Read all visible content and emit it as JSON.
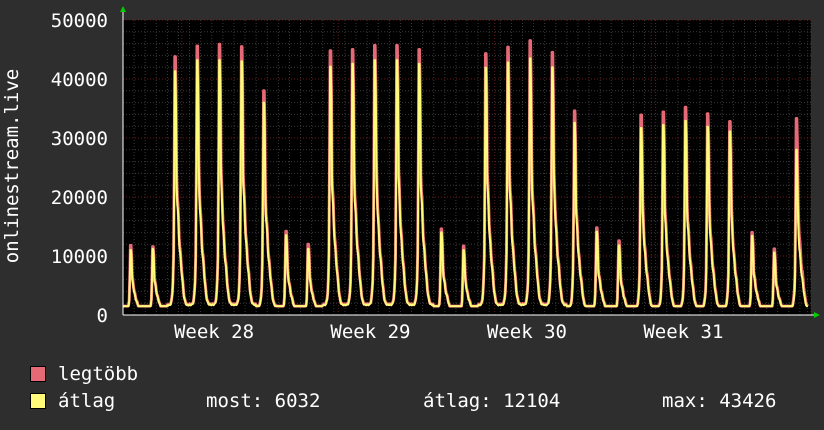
{
  "colors": {
    "background": "#2e2e2e",
    "plot_background": "#000000",
    "grid_minor": "#3a3a3a",
    "grid_major": "#6a1a1a",
    "max_series": "#e66a75",
    "avg_series": "#fffa7a",
    "text": "#ffffff",
    "arrow": "#00cc00"
  },
  "chart_data": {
    "type": "area",
    "title": "",
    "ylabel": "onlinestream.live",
    "ylim": [
      0,
      50000
    ],
    "yticks": [
      0,
      10000,
      20000,
      30000,
      40000,
      50000
    ],
    "ytick_labels": [
      "0",
      "10000",
      "20000",
      "30000",
      "40000",
      "50000"
    ],
    "xlabels": [
      "Week 28",
      "Week 29",
      "Week 30",
      "Week 31"
    ],
    "days": 31,
    "grid": true,
    "series": [
      {
        "name": "legtöbb",
        "daily_peaks": [
          11800,
          11600,
          43800,
          45600,
          45900,
          45500,
          38000,
          14200,
          12000,
          44800,
          45000,
          45700,
          45700,
          45000,
          14600,
          11700,
          44300,
          45400,
          46500,
          44500,
          34600,
          14800,
          12600,
          33900,
          34400,
          35200,
          34100,
          32800,
          14000,
          11200,
          33300
        ]
      },
      {
        "name": "átlag",
        "daily_peaks": [
          11000,
          11200,
          41300,
          43200,
          43200,
          43000,
          36000,
          13500,
          11200,
          42100,
          42600,
          43200,
          43200,
          42600,
          14000,
          11000,
          41900,
          42800,
          43500,
          42000,
          32600,
          14100,
          11800,
          31700,
          32200,
          32900,
          31900,
          31100,
          13400,
          10600,
          28000
        ]
      }
    ]
  },
  "legend": {
    "max_label": "legtöbb",
    "avg_label": "átlag",
    "now_label": "most:",
    "now_value": "6032",
    "avg_stat_label": "átlag:",
    "avg_stat_value": "12104",
    "max_stat_label": "max:",
    "max_stat_value": "43426"
  }
}
